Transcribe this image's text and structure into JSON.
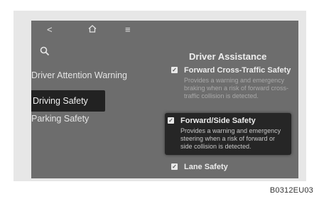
{
  "screen": {
    "section_title": "Driver Assistance",
    "nav": [
      {
        "label": "Driver Attention Warning"
      },
      {
        "label": "Driving Safety"
      },
      {
        "label": "Parking Safety"
      }
    ],
    "options": [
      {
        "title": "Forward Cross-Traffic Safety",
        "description": "Provides a warning and emergency braking when a risk of forward cross-traffic collision is detected.",
        "checked": true
      },
      {
        "title": "Forward/Side Safety",
        "description": "Provides a warning and emergency steering when a risk of forward or side collision is detected.",
        "checked": true
      },
      {
        "title": "Lane Safety",
        "description": "",
        "checked": true
      }
    ]
  },
  "figure_code": "B0312EU03",
  "icons": [
    "back-icon",
    "home-icon",
    "menu-icon",
    "search-icon",
    "checkbox-icon"
  ]
}
